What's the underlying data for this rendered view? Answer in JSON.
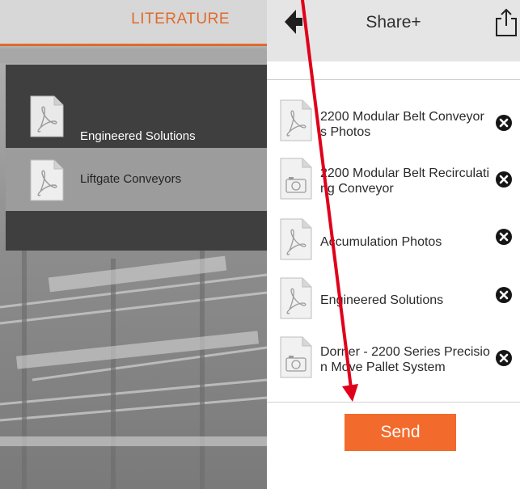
{
  "literature": {
    "title": "LITERATURE",
    "items": [
      {
        "label": "Engineered Solutions",
        "icon": "pdf-icon",
        "selected": false
      },
      {
        "label": "Liftgate Conveyors",
        "icon": "pdf-icon",
        "selected": true
      }
    ]
  },
  "share": {
    "title": "Share+",
    "back_icon": "back-arrow-icon",
    "export_icon": "share-export-icon",
    "items": [
      {
        "name": "2200 Modular Belt Conveyors Photos",
        "icon": "pdf-icon"
      },
      {
        "name": "2200 Modular Belt Recirculating Conveyor",
        "icon": "photo-icon"
      },
      {
        "name": "Accumulation Photos",
        "icon": "pdf-icon"
      },
      {
        "name": "Engineered Solutions",
        "icon": "pdf-icon"
      },
      {
        "name": "Dorner - 2200 Series Precision Move Pallet System",
        "icon": "photo-icon"
      }
    ],
    "remove_icon": "remove-x-icon",
    "send_label": "Send"
  },
  "colors": {
    "accent": "#f26a2c",
    "header_orange_text": "#e06a2c",
    "dark_panel": "#3f3f3f",
    "annotation_red": "#e0001a"
  }
}
